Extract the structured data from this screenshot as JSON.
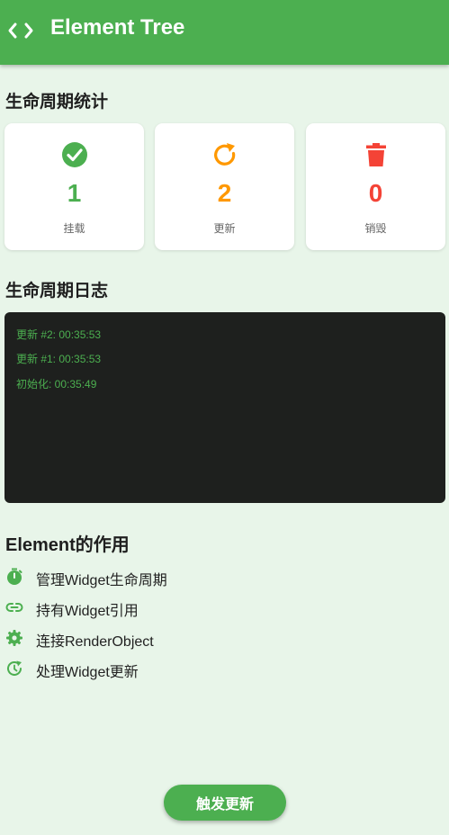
{
  "appbar": {
    "title": "Element Tree",
    "icon": "code-icon",
    "color": "#4caf50"
  },
  "stats": {
    "title": "生命周期统计",
    "cards": [
      {
        "icon": "check-circle-icon",
        "value": "1",
        "label": "挂载",
        "color": "#4caf50"
      },
      {
        "icon": "refresh-icon",
        "value": "2",
        "label": "更新",
        "color": "#ff9800"
      },
      {
        "icon": "trash-icon",
        "value": "0",
        "label": "销毁",
        "color": "#f44336"
      }
    ]
  },
  "log": {
    "title": "生命周期日志",
    "entries": [
      "更新 #2: 00:35:53",
      "更新 #1: 00:35:53",
      "初始化: 00:35:49"
    ]
  },
  "features": {
    "title": "Element的作用",
    "items": [
      {
        "icon": "timer-icon",
        "label": "管理Widget生命周期"
      },
      {
        "icon": "link-icon",
        "label": "持有Widget引用"
      },
      {
        "icon": "gear-icon",
        "label": "连接RenderObject"
      },
      {
        "icon": "update-icon",
        "label": "处理Widget更新"
      }
    ]
  },
  "action": {
    "label": "触发更新"
  }
}
